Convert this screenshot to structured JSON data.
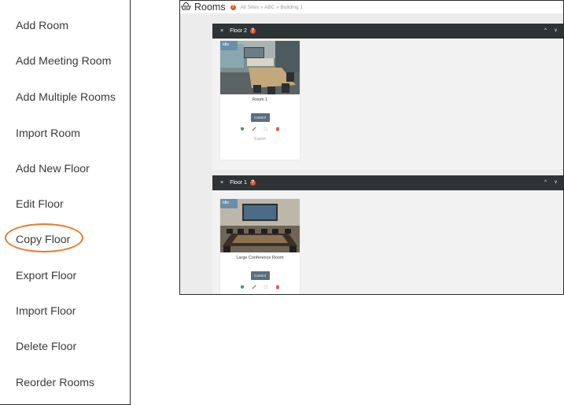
{
  "menu": {
    "items": [
      {
        "label": "Add Room"
      },
      {
        "label": "Add Meeting Room"
      },
      {
        "label": "Add Multiple Rooms"
      },
      {
        "label": "Import Room"
      },
      {
        "label": "Add New Floor"
      },
      {
        "label": "Edit Floor"
      },
      {
        "label": "Copy Floor",
        "highlighted": true
      },
      {
        "label": "Export Floor"
      },
      {
        "label": "Import Floor"
      },
      {
        "label": "Delete Floor"
      },
      {
        "label": "Reorder Rooms"
      }
    ],
    "highlight_color": "#e87a2a"
  },
  "app": {
    "title": "Rooms",
    "help": "?",
    "breadcrumb": "All Sites » ABC » Building 1",
    "floors": [
      {
        "close": "×",
        "name": "Floor 2",
        "help": "?",
        "ctrl_up": "^",
        "ctrl_down": "v",
        "ctrl_more": "⋮",
        "room": {
          "status": "Idle",
          "name": "Room 1",
          "control_label": "Control",
          "export_label": "Export"
        }
      },
      {
        "close": "×",
        "name": "Floor 1",
        "help": "?",
        "ctrl_up": "^",
        "ctrl_down": "v",
        "ctrl_more": "⋮",
        "room": {
          "status": "Idle",
          "name": "Large Conference Room",
          "control_label": "Control"
        }
      }
    ],
    "colors": {
      "floor_header": "#2e3336",
      "status_tag": "#6b8fa8",
      "control_button": "#5b6e7e",
      "help_dot": "#e2572b",
      "online_icon": "#3fa34d",
      "delete_icon": "#d9534f"
    }
  }
}
